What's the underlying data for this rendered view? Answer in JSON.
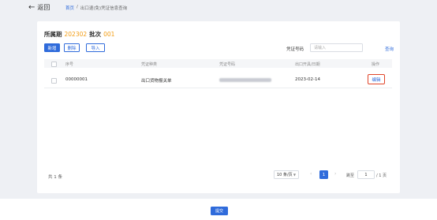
{
  "header": {
    "back_label": "返回",
    "breadcrumb_home": "首页",
    "breadcrumb_sep": "/",
    "breadcrumb_current": "出口退(免)凭证信息查询"
  },
  "summary": {
    "period_label": "所属期",
    "period_value": "202302",
    "batch_label": "批次",
    "batch_value": "001"
  },
  "toolbar": {
    "add_label": "新增",
    "delete_label": "删除",
    "import_label": "导入"
  },
  "filter": {
    "voucher_no_label": "凭证号码",
    "voucher_no_placeholder": "请输入",
    "query_label": "查询"
  },
  "table": {
    "columns": [
      "序号",
      "凭证种类",
      "凭证号码",
      "出口开具/日期",
      "操作"
    ],
    "rows": [
      {
        "seq": "00000001",
        "type": "出口货物报关单",
        "date": "2023-02-14",
        "action": "编辑"
      }
    ]
  },
  "pagination": {
    "total_label": "共 1 条",
    "page_size": "10 条/页",
    "prev": "‹",
    "current_page": "1",
    "next": "›",
    "jump_label": "跳至",
    "jump_value": "1",
    "total_pages": "/ 1 页"
  },
  "footer": {
    "submit_label": "提交"
  },
  "colors": {
    "primary": "#2f6bdb",
    "accent": "#f39c12",
    "highlight": "#e0452a"
  },
  "icons": {
    "back": "arrow-left-icon",
    "dropdown": "chevron-down-icon"
  }
}
